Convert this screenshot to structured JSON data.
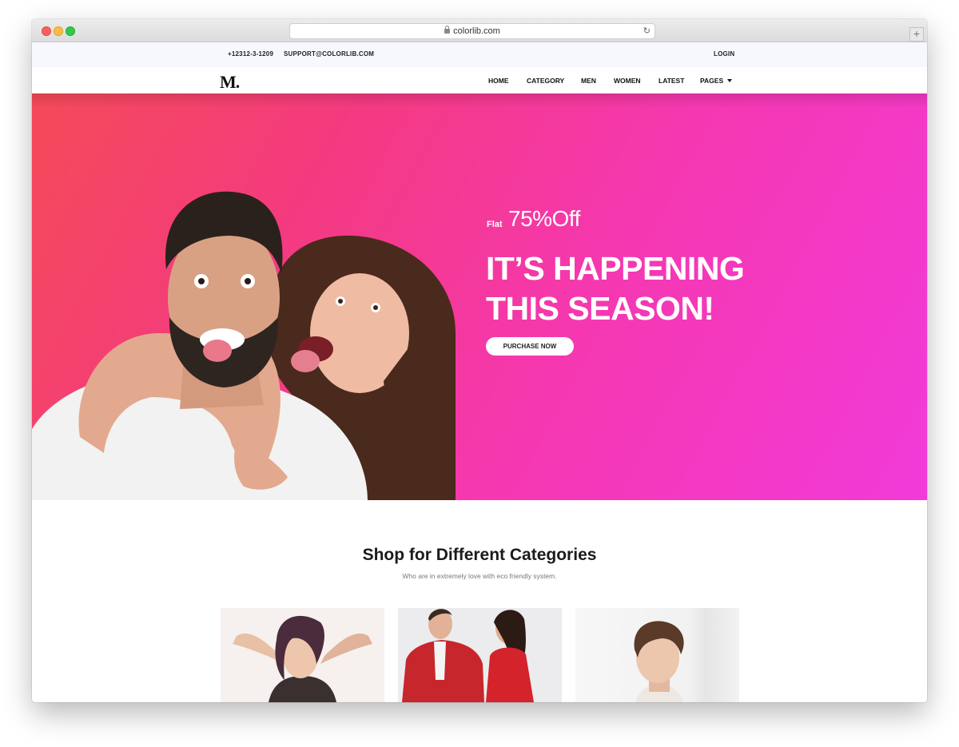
{
  "browser": {
    "url": "colorlib.com"
  },
  "topbar": {
    "phone": "+12312-3-1209",
    "email": "SUPPORT@COLORLIB.COM",
    "login": "LOGIN"
  },
  "nav": {
    "logo": "M.",
    "items": [
      "HOME",
      "CATEGORY",
      "MEN",
      "WOMEN",
      "LATEST",
      "PAGES"
    ]
  },
  "hero": {
    "flat_label": "Flat",
    "offer": "75%Off",
    "headline_line1": "IT’S HAPPENING",
    "headline_line2": "THIS SEASON!",
    "cta": "PURCHASE NOW",
    "gradient_colors": [
      "#f54a58",
      "#f43a80",
      "#f538b0",
      "#f23ad9"
    ]
  },
  "categories": {
    "title": "Shop for Different Categories",
    "subtitle": "Who are in extremely love with eco friendly system."
  },
  "icons": [
    "lock-icon",
    "reload-icon",
    "new-tab-icon",
    "caret-down-icon"
  ]
}
